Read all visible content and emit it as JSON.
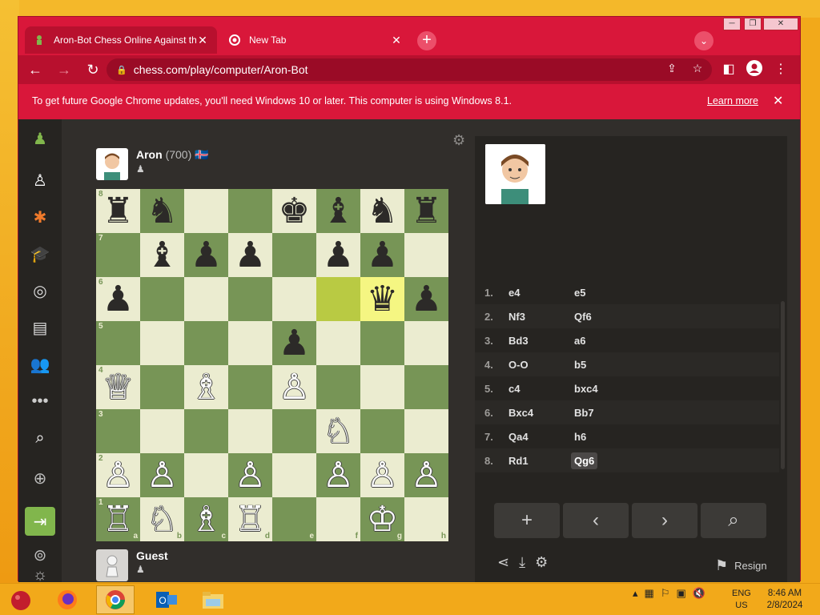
{
  "browser": {
    "tabs": [
      {
        "label": "Aron-Bot Chess Online Against th",
        "close": "✕"
      },
      {
        "label": "New Tab",
        "close": "✕"
      }
    ],
    "new_tab": "+",
    "url": "chess.com/play/computer/Aron-Bot",
    "infobar": {
      "message": "To get future Google Chrome updates, you'll need Windows 10 or later. This computer is using Windows 8.1.",
      "learn_more": "Learn more",
      "close": "✕"
    }
  },
  "game": {
    "top_player": {
      "name": "Aron",
      "rating": "(700)",
      "flag": "🇮🇸"
    },
    "bottom_player": {
      "name": "Guest"
    },
    "highlight": {
      "from": "f6",
      "to": "g6"
    },
    "board": [
      [
        "♜",
        "♞",
        "",
        "",
        "♚",
        "♝",
        "♞",
        "♜"
      ],
      [
        "",
        "♝",
        "♟",
        "♟",
        "",
        "♟",
        "♟",
        ""
      ],
      [
        "♟",
        "",
        "",
        "",
        "",
        "",
        "♛",
        "♟"
      ],
      [
        "",
        "",
        "",
        "",
        "♟",
        "",
        "",
        ""
      ],
      [
        "♕",
        "",
        "♗",
        "",
        "♙",
        "",
        "",
        ""
      ],
      [
        "",
        "",
        "",
        "",
        "",
        "♘",
        "",
        ""
      ],
      [
        "♙",
        "♙",
        "",
        "♙",
        "",
        "♙",
        "♙",
        "♙"
      ],
      [
        "♖",
        "♘",
        "♗",
        "♖",
        "",
        "",
        "♔",
        ""
      ]
    ],
    "ranks": [
      "8",
      "7",
      "6",
      "5",
      "4",
      "3",
      "2",
      "1"
    ],
    "files": [
      "a",
      "b",
      "c",
      "d",
      "e",
      "f",
      "g",
      "h"
    ],
    "moves": [
      {
        "no": "1.",
        "white": "e4",
        "black": "e5"
      },
      {
        "no": "2.",
        "white": "Nf3",
        "black": "Qf6"
      },
      {
        "no": "3.",
        "white": "Bd3",
        "black": "a6"
      },
      {
        "no": "4.",
        "white": "O-O",
        "black": "b5"
      },
      {
        "no": "5.",
        "white": "c4",
        "black": "bxc4"
      },
      {
        "no": "6.",
        "white": "Bxc4",
        "black": "Bb7"
      },
      {
        "no": "7.",
        "white": "Qa4",
        "black": "h6"
      },
      {
        "no": "8.",
        "white": "Rd1",
        "black": "Qg6"
      }
    ],
    "resign": "Resign"
  },
  "taskbar": {
    "lang": "ENG",
    "region": "US",
    "time": "8:46 AM",
    "date": "2/8/2024"
  }
}
